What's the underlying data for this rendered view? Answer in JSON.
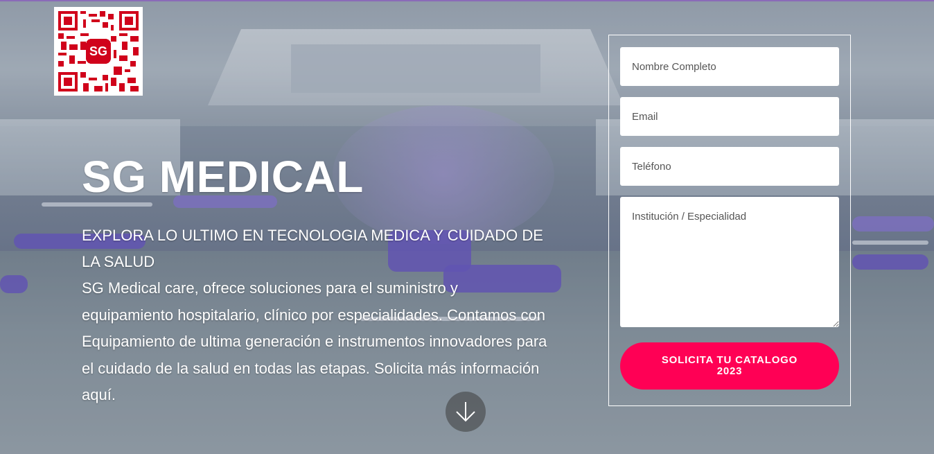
{
  "hero": {
    "title": "SG MEDICAL",
    "tagline": " EXPLORA LO ULTIMO EN TECNOLOGIA MEDICA Y CUIDADO DE LA SALUD",
    "description": "SG Medical care, ofrece soluciones para el suministro y equipamiento hospitalario, clínico por especialidades. Contamos con Equipamiento de ultima generación e instrumentos innovadores para el cuidado de la salud en todas las etapas. Solicita más información aquí.",
    "scroll_icon": "arrow-down-icon"
  },
  "qr": {
    "logo_text": "SG",
    "color": "#d0021b"
  },
  "form": {
    "name_placeholder": "Nombre Completo",
    "email_placeholder": "Email",
    "phone_placeholder": "Teléfono",
    "institution_placeholder": "Institución / Especialidad",
    "submit_label": "SOLICITA TU CATALOGO 2023"
  },
  "colors": {
    "accent": "#ff0055",
    "text": "#ffffff",
    "top_border": "#8a6ab8"
  }
}
